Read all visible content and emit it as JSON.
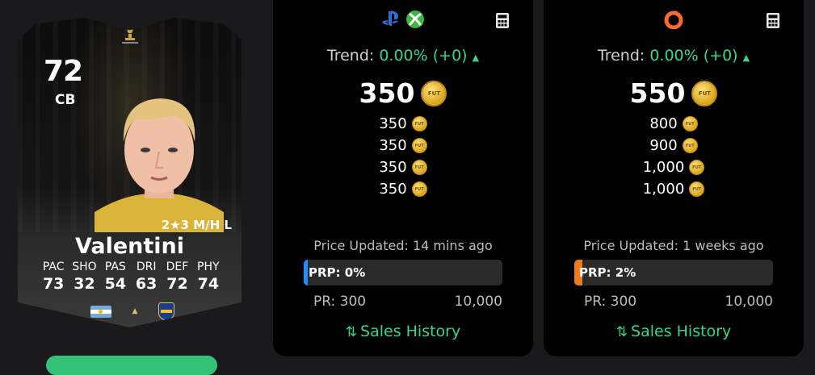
{
  "player": {
    "rating": "72",
    "position": "CB",
    "skills_weakfoot": "2★3 M/H L",
    "name": "Valentini",
    "stats": [
      {
        "label": "PAC",
        "value": "73"
      },
      {
        "label": "SHO",
        "value": "32"
      },
      {
        "label": "PAS",
        "value": "54"
      },
      {
        "label": "DRI",
        "value": "63"
      },
      {
        "label": "DEF",
        "value": "72"
      },
      {
        "label": "PHY",
        "value": "74"
      }
    ],
    "badges": {
      "league_text": "LIBERTADORES"
    }
  },
  "panels": {
    "console": {
      "platform_icons": [
        "playstation-icon",
        "xbox-icon"
      ],
      "trend_label": "Trend:",
      "trend_value": "0.00% (+0)",
      "trend_arrow": "▲",
      "price": "350",
      "coin_text": "FUT",
      "listings": [
        "350",
        "350",
        "350",
        "350"
      ],
      "updated": "Price Updated: 14 mins ago",
      "prp": "PRP: 0%",
      "prp_percent": 0,
      "prp_color": "#1e90ff",
      "pr_min": "PR: 300",
      "pr_max": "10,000",
      "sales_history": "Sales History"
    },
    "pc": {
      "platform_icons": [
        "origin-icon"
      ],
      "trend_label": "Trend:",
      "trend_value": "0.00% (+0)",
      "trend_arrow": "▲",
      "price": "550",
      "coin_text": "FUT",
      "listings": [
        "800",
        "900",
        "1,000",
        "1,000"
      ],
      "updated": "Price Updated: 1 weeks ago",
      "prp": "PRP: 2%",
      "prp_percent": 2,
      "prp_color": "#f07a1e",
      "pr_min": "PR: 300",
      "pr_max": "10,000",
      "sales_history": "Sales History"
    }
  },
  "colors": {
    "accent_green": "#35d88a",
    "panel_bg": "#000000",
    "page_bg": "#1a1a1c"
  }
}
